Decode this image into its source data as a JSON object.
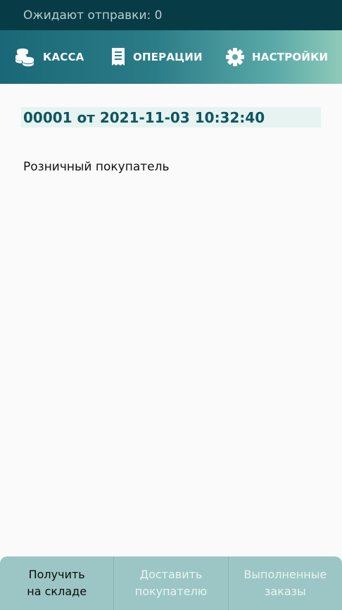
{
  "status": {
    "pending_label": "Ожидают отправки: 0"
  },
  "nav": {
    "items": [
      {
        "label": "КАССА",
        "icon": "coins-icon"
      },
      {
        "label": "ОПЕРАЦИИ",
        "icon": "receipt-icon"
      },
      {
        "label": "НАСТРОЙКИ",
        "icon": "gear-icon"
      }
    ]
  },
  "document": {
    "header": "00001 от 2021-11-03 10:32:40",
    "customer": "Розничный покупатель"
  },
  "tabs": [
    {
      "line1": "Получить",
      "line2": "на складе",
      "active": true
    },
    {
      "line1": "Доставить",
      "line2": "покупателю",
      "active": false
    },
    {
      "line1": "Выполненные",
      "line2": "заказы",
      "active": false
    }
  ],
  "colors": {
    "status_bg": "#073c47",
    "header_accent": "#0e5563",
    "header_bg": "#e6f3f0",
    "tabs_bg": "#9cc6c6"
  }
}
